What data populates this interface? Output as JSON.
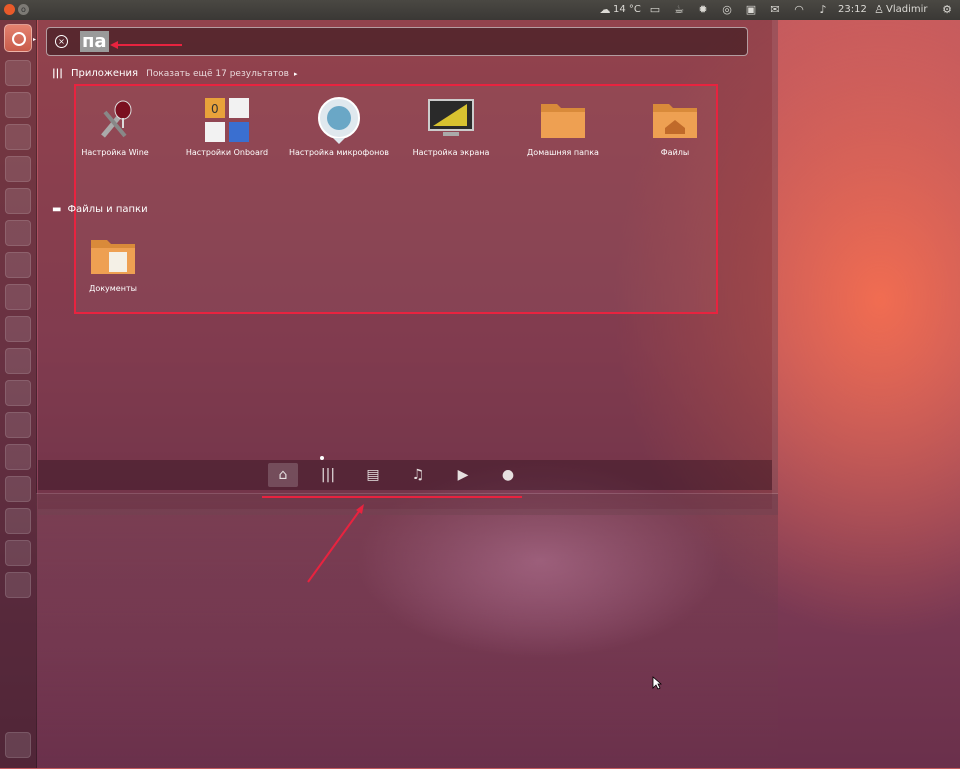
{
  "top_panel": {
    "weather": "14 °C",
    "time": "23:12",
    "user": "Vladimir"
  },
  "search": {
    "query": "па"
  },
  "applications": {
    "heading": "Приложения",
    "more_link": "Показать ещё 17 результатов",
    "items": [
      {
        "label": "Настройка Wine",
        "icon": "wine-config-icon"
      },
      {
        "label": "Настройки Onboard",
        "icon": "onboard-settings-icon"
      },
      {
        "label": "Настройка микрофонов",
        "icon": "microphone-settings-icon"
      },
      {
        "label": "Настройка экрана",
        "icon": "display-settings-icon"
      },
      {
        "label": "Домашняя папка",
        "icon": "home-folder-icon"
      },
      {
        "label": "Файлы",
        "icon": "files-icon"
      }
    ]
  },
  "files_section": {
    "heading": "Файлы и папки",
    "items": [
      {
        "label": "Документы",
        "icon": "documents-folder-icon"
      }
    ]
  },
  "lenses": [
    {
      "name": "home-lens",
      "icon": "home-icon",
      "active": true
    },
    {
      "name": "applications-lens",
      "icon": "applications-icon",
      "active": false
    },
    {
      "name": "files-lens",
      "icon": "files-icon",
      "active": false
    },
    {
      "name": "music-lens",
      "icon": "music-icon",
      "active": false
    },
    {
      "name": "video-lens",
      "icon": "video-icon",
      "active": false
    },
    {
      "name": "social-lens",
      "icon": "social-icon",
      "active": false
    }
  ],
  "colors": {
    "highlight": "#e8233f",
    "accent": "#e85a2a"
  }
}
